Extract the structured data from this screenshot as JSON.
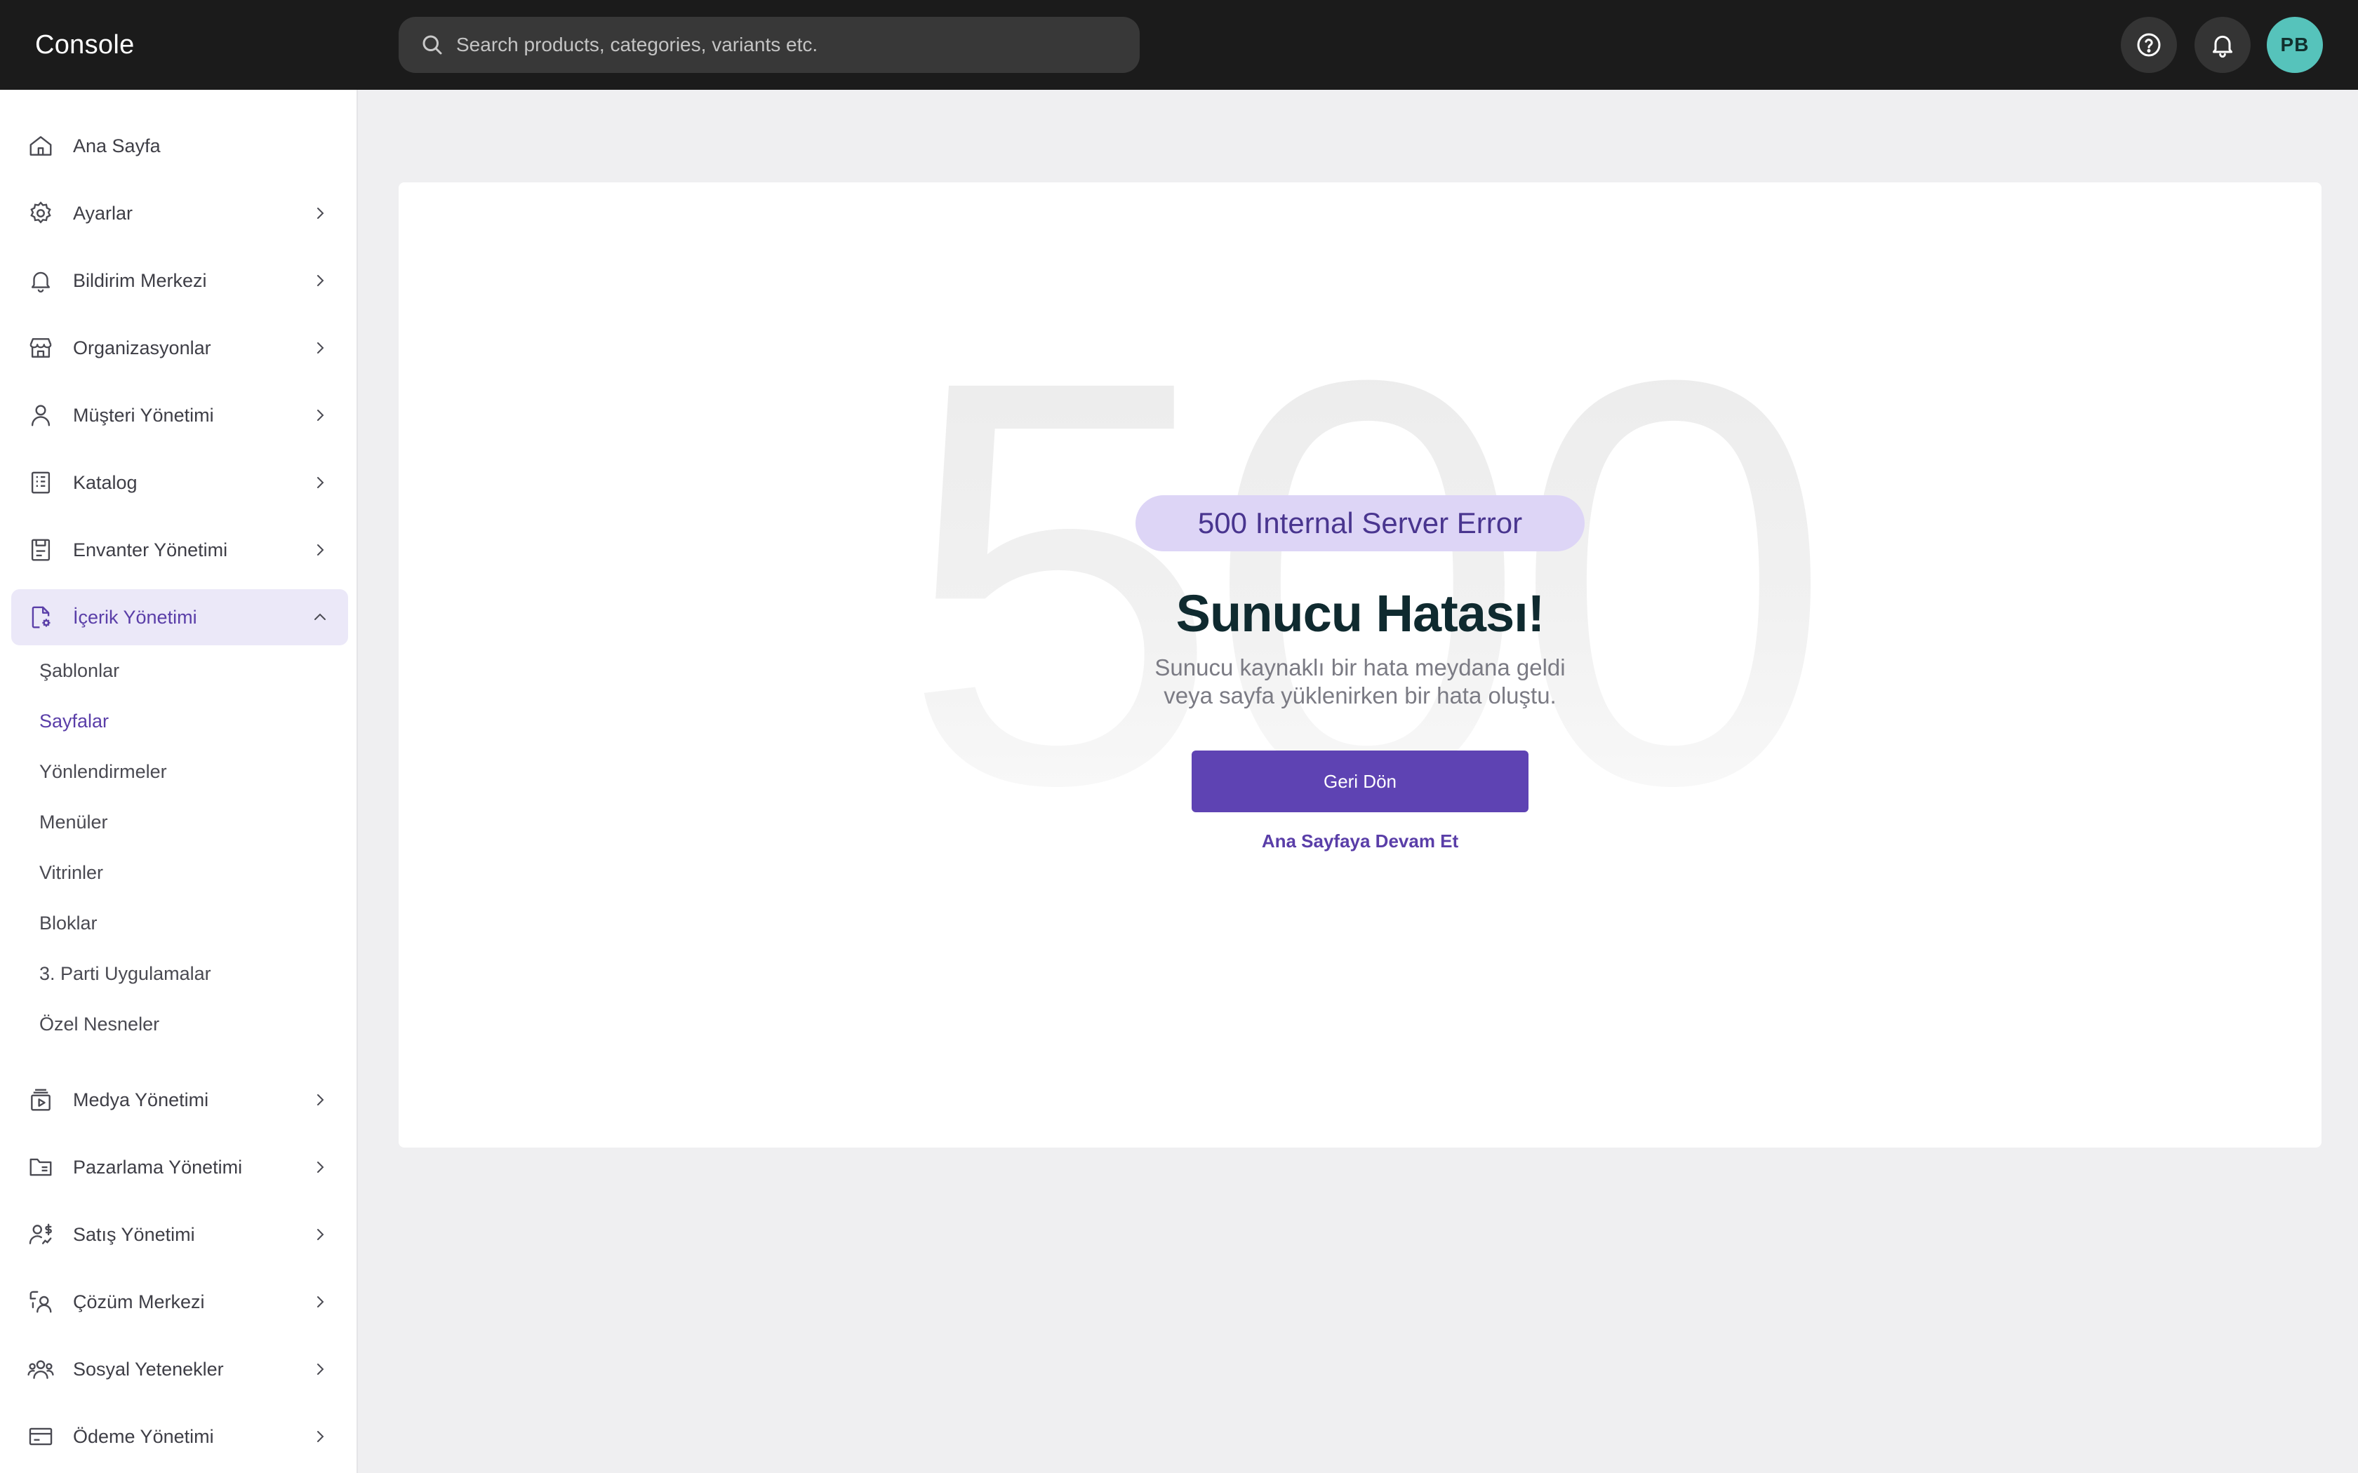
{
  "app": {
    "brand": "Console"
  },
  "search": {
    "placeholder": "Search products, categories, variants etc.",
    "icon": "search-icon"
  },
  "header": {
    "help_icon": "help-circle-icon",
    "notifications_icon": "bell-icon",
    "avatar_initials": "PB",
    "avatar_color": "#56c3bb"
  },
  "sidebar": {
    "items": [
      {
        "label": "Ana Sayfa",
        "icon": "home-icon",
        "has_children": false
      },
      {
        "label": "Ayarlar",
        "icon": "gear-icon",
        "has_children": true
      },
      {
        "label": "Bildirim Merkezi",
        "icon": "bell-icon",
        "has_children": true
      },
      {
        "label": "Organizasyonlar",
        "icon": "store-icon",
        "has_children": true
      },
      {
        "label": "Müşteri Yönetimi",
        "icon": "user-icon",
        "has_children": true
      },
      {
        "label": "Katalog",
        "icon": "catalog-icon",
        "has_children": true
      },
      {
        "label": "Envanter Yönetimi",
        "icon": "inventory-icon",
        "has_children": true
      },
      {
        "label": "İçerik Yönetimi",
        "icon": "content-settings-icon",
        "has_children": true,
        "expanded": true,
        "active": true
      },
      {
        "label": "Medya Yönetimi",
        "icon": "media-icon",
        "has_children": true
      },
      {
        "label": "Pazarlama Yönetimi",
        "icon": "folder-icon",
        "has_children": true
      },
      {
        "label": "Satış Yönetimi",
        "icon": "sales-user-icon",
        "has_children": true
      },
      {
        "label": "Çözüm Merkezi",
        "icon": "support-icon",
        "has_children": true
      },
      {
        "label": "Sosyal Yetenekler",
        "icon": "users-icon",
        "has_children": true
      },
      {
        "label": "Ödeme Yönetimi",
        "icon": "credit-card-icon",
        "has_children": true
      }
    ],
    "subitems": [
      {
        "label": "Şablonlar"
      },
      {
        "label": "Sayfalar",
        "active": true
      },
      {
        "label": "Yönlendirmeler"
      },
      {
        "label": "Menüler"
      },
      {
        "label": "Vitrinler"
      },
      {
        "label": "Bloklar"
      },
      {
        "label": "3. Parti Uygulamalar"
      },
      {
        "label": "Özel Nesneler"
      }
    ]
  },
  "error": {
    "code": "500",
    "badge": "500 Internal Server Error",
    "title": "Sunucu Hatası!",
    "message_line1": "Sunucu kaynaklı bir hata meydana geldi",
    "message_line2": "veya sayfa yüklenirken bir hata oluştu.",
    "back_button": "Geri Dön",
    "home_link": "Ana Sayfaya Devam Et"
  },
  "colors": {
    "accent": "#5e43b3",
    "accent_light": "#ebe8f8",
    "topbar": "#1b1b1b"
  }
}
